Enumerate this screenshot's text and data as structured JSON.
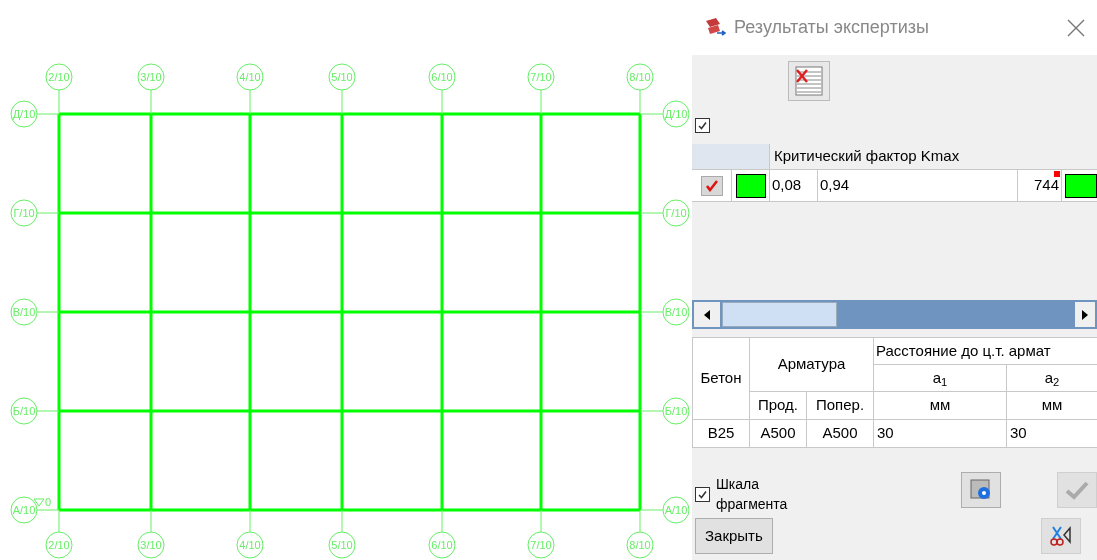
{
  "drawing": {
    "axes_top": [
      "2/10",
      "3/10",
      "4/10",
      "5/10",
      "6/10",
      "7/10",
      "8/10"
    ],
    "axes_bottom": [
      "2/10",
      "3/10",
      "4/10",
      "5/10",
      "6/10",
      "7/10",
      "8/10"
    ],
    "axes_left": [
      "Д/10",
      "Г/10",
      "В/10",
      "Б/10",
      "А/10"
    ],
    "axes_right": [
      "Д/10",
      "Г/10",
      "В/10",
      "Б/10",
      "А/10"
    ],
    "elevation_mark": "0"
  },
  "panel": {
    "title": "Результаты экспертизы",
    "show_all_checked": true,
    "results_table": {
      "header": "Критический фактор Kmax",
      "rows": [
        {
          "checked": true,
          "swatches": [
            {
              "color": "#00ff00"
            },
            {
              "color": "#00ff00"
            }
          ],
          "cells": [
            "0,08",
            "0,94",
            "744"
          ],
          "flagged": true
        }
      ]
    },
    "materials_table": {
      "concrete": "Бетон",
      "rebar": "Арматура",
      "distance": "Расстояние до ц.т. армат",
      "longitudinal": "Прод.",
      "transverse": "Попер.",
      "a1": "a$_{1}$",
      "a2": "a$_{2}$",
      "unit1": "мм",
      "unit2": "мм",
      "rows": [
        [
          "B25",
          "A500",
          "A500",
          "30",
          "30"
        ]
      ]
    },
    "scale_checkbox": {
      "label": "Шкала фрагмента",
      "checked": true
    },
    "close_button": "Закрыть"
  }
}
